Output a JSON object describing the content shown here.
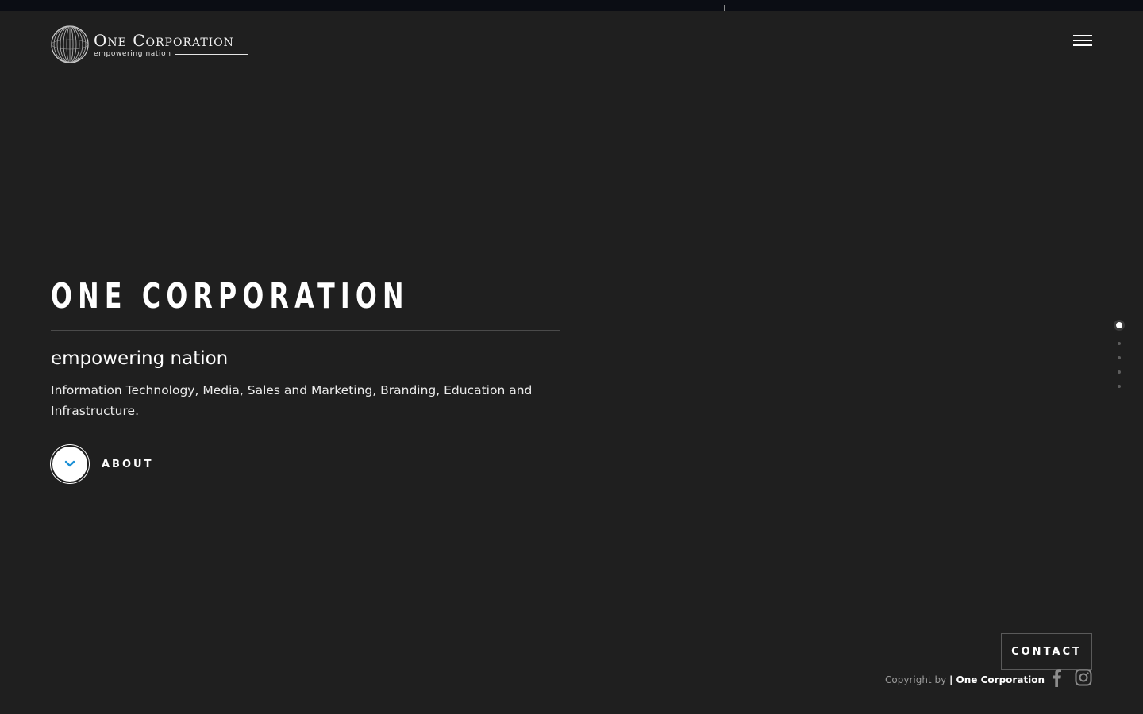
{
  "brand": {
    "name": "One Corporation",
    "tagline": "empowering nation"
  },
  "hero": {
    "title": "ONE CORPORATION",
    "subtitle": "empowering nation",
    "description": "Information Technology, Media, Sales and Marketing, Branding, Education and Infrastructure.",
    "scroll_label": "ABOUT",
    "accent_color": "#1a8fd6"
  },
  "nav": {
    "menu_icon": "hamburger-icon",
    "pager_count": 5,
    "pager_active": 1
  },
  "footer": {
    "contact_label": "CONTACT",
    "copyright_prefix": "Copyright by",
    "copyright_brand": "| One Corporation",
    "social": [
      "facebook-icon",
      "instagram-icon"
    ]
  }
}
